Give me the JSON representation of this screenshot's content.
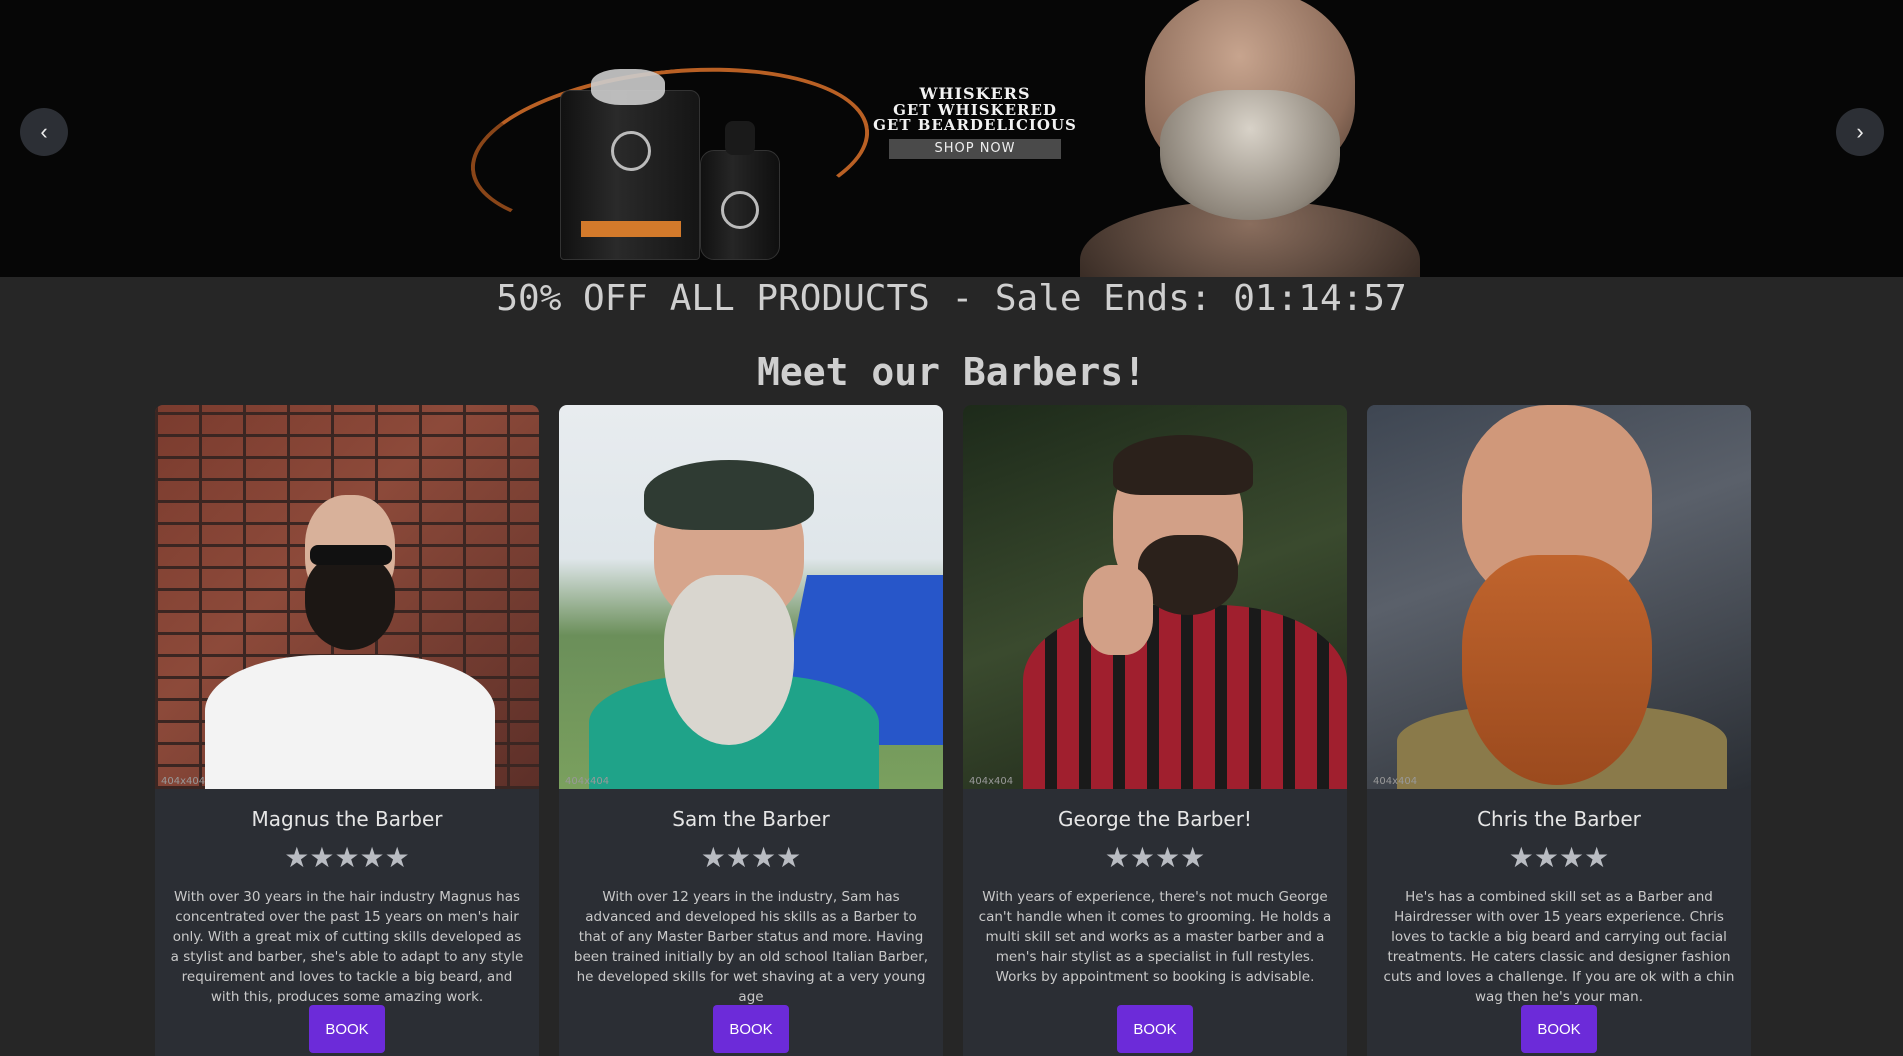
{
  "banner": {
    "brand_logo": "WHISKERS",
    "line1": "GET WHISKERED",
    "line2": "GET BEARDELICIOUS",
    "shop_label": "SHOP NOW",
    "prev_label": "‹",
    "next_label": "›"
  },
  "sale_text": "50% OFF ALL PRODUCTS - Sale Ends: 01:14:57",
  "section_heading": "Meet our Barbers!",
  "cards": [
    {
      "name": "Magnus the Barber",
      "stars": "★★★★★",
      "rating": 5,
      "dims": "404x404",
      "description": "With over 30 years in the hair industry Magnus has concentrated over the past 15 years on men's hair only. With a great mix of cutting skills developed as a stylist and barber, she's able to adapt to any style requirement and loves to tackle a big beard, and with this, produces some amazing work.",
      "book_label": "BOOK"
    },
    {
      "name": "Sam the Barber",
      "stars": "★★★★",
      "rating": 4,
      "dims": "404x404",
      "description": "With over 12 years in the industry, Sam has advanced and developed his skills as a Barber to that of any Master Barber status and more. Having been trained initially by an old school Italian Barber, he developed skills for wet shaving at a very young age",
      "book_label": "BOOK"
    },
    {
      "name": "George the Barber!",
      "stars": "★★★★",
      "rating": 4,
      "dims": "404x404",
      "description": "With years of experience, there's not much George can't handle when it comes to grooming. He holds a multi skill set and works as a master barber and a men's hair stylist as a specialist in full restyles. Works by appointment so booking is advisable.",
      "book_label": "BOOK"
    },
    {
      "name": "Chris the Barber",
      "stars": "★★★★",
      "rating": 4,
      "dims": "404x404",
      "description": "He's has a combined skill set as a Barber and Hairdresser with over 15 years experience. Chris loves to tackle a big beard and carrying out facial treatments. He caters classic and designer fashion cuts and loves a challenge. If you are ok with a chin wag then he's your man.",
      "book_label": "BOOK"
    }
  ],
  "colors": {
    "page_bg": "#262626",
    "card_bg": "#2b2e34",
    "book_button": "#6c2bd9",
    "banner_accent": "#d9702a"
  }
}
